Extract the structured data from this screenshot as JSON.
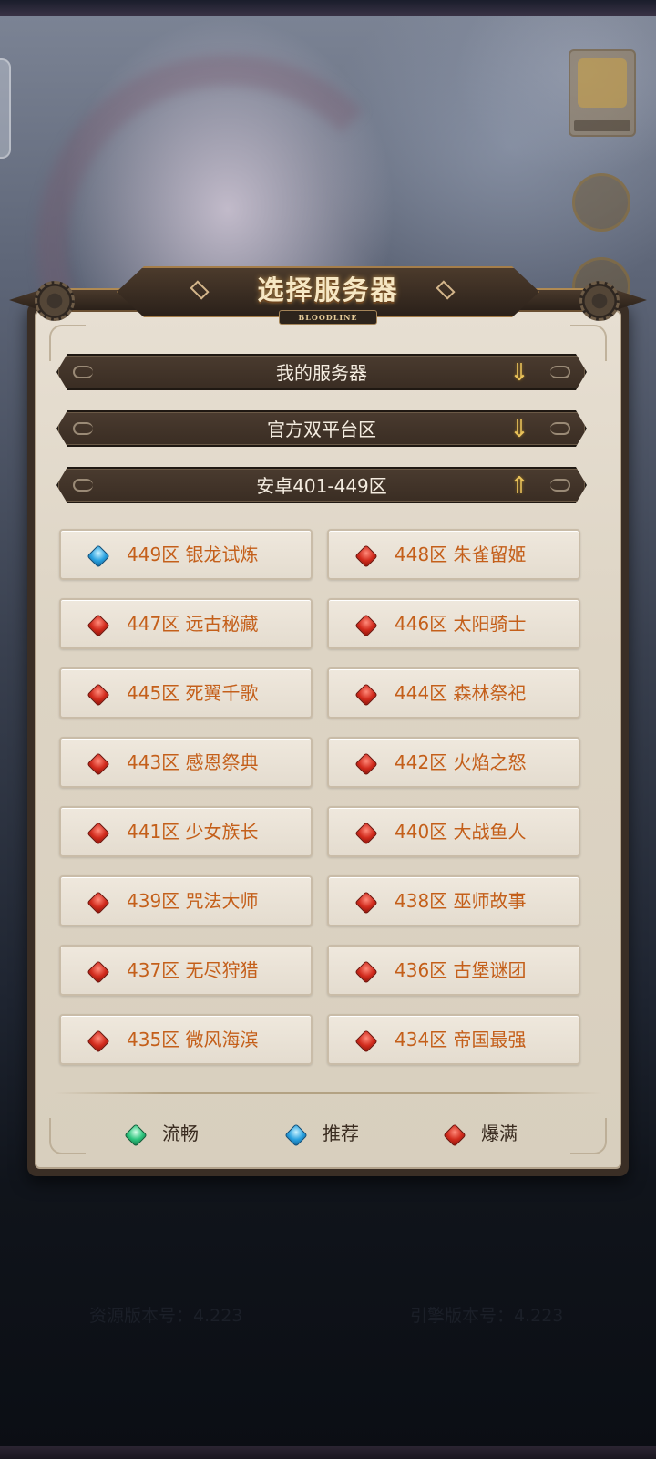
{
  "title": "选择服务器",
  "logo_text": "BLOODLINE",
  "categories": [
    {
      "label": "我的服务器",
      "arrow": "⇓"
    },
    {
      "label": "官方双平台区",
      "arrow": "⇓"
    },
    {
      "label": "安卓401-449区",
      "arrow": "⇑"
    }
  ],
  "servers": [
    {
      "label": "449区 银龙试炼",
      "status": "blue"
    },
    {
      "label": "448区 朱雀留姬",
      "status": "red"
    },
    {
      "label": "447区 远古秘藏",
      "status": "red"
    },
    {
      "label": "446区 太阳骑士",
      "status": "red"
    },
    {
      "label": "445区 死翼千歌",
      "status": "red"
    },
    {
      "label": "444区 森林祭祀",
      "status": "red"
    },
    {
      "label": "443区 感恩祭典",
      "status": "red"
    },
    {
      "label": "442区 火焰之怒",
      "status": "red"
    },
    {
      "label": "441区 少女族长",
      "status": "red"
    },
    {
      "label": "440区 大战鱼人",
      "status": "red"
    },
    {
      "label": "439区 咒法大师",
      "status": "red"
    },
    {
      "label": "438区 巫师故事",
      "status": "red"
    },
    {
      "label": "437区 无尽狩猎",
      "status": "red"
    },
    {
      "label": "436区 古堡谜团",
      "status": "red"
    },
    {
      "label": "435区 微风海滨",
      "status": "red"
    },
    {
      "label": "434区 帝国最强",
      "status": "red"
    }
  ],
  "legend": [
    {
      "label": "流畅",
      "color": "green"
    },
    {
      "label": "推荐",
      "color": "blue"
    },
    {
      "label": "爆满",
      "color": "red"
    }
  ],
  "version": {
    "resource": "资源版本号：4.223",
    "engine": "引擎版本号：4.223"
  },
  "colors": {
    "server_text": "#c45f1a",
    "gem_red": "#d22c1e",
    "gem_blue": "#2aa2e0",
    "gem_green": "#2ec57e"
  }
}
